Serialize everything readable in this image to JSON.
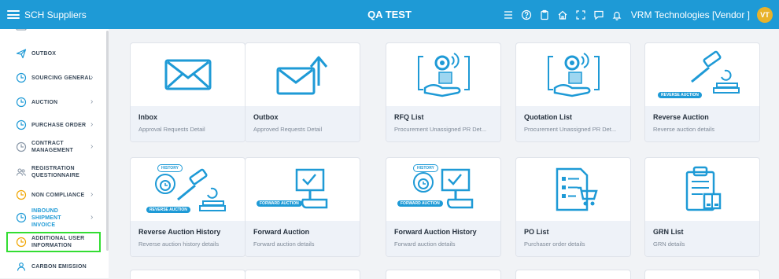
{
  "topbar": {
    "app_name": "SCH Suppliers",
    "title": "QA TEST",
    "user": "VRM Technologies  [Vendor ]",
    "avatar_initials": "VT",
    "accent": "#1e9ad6"
  },
  "sidebar": {
    "items": [
      {
        "label": "OUTBOX",
        "icon": "send-icon",
        "chevron": false
      },
      {
        "label": "SOURCING GENERAL",
        "icon": "clock-icon",
        "chevron": true
      },
      {
        "label": "AUCTION",
        "icon": "clock-icon",
        "chevron": true
      },
      {
        "label": "PURCHASE ORDER",
        "icon": "clock-icon",
        "chevron": true
      },
      {
        "label": "CONTRACT MANAGEMENT",
        "icon": "clock-icon",
        "chevron": true
      },
      {
        "label": "REGISTRATION QUESTIONNAIRE",
        "icon": "users-icon",
        "chevron": false
      },
      {
        "label": "NON COMPLIANCE",
        "icon": "clock-icon",
        "chevron": true
      },
      {
        "label": "INBOUND SHIPMENT INVOICE",
        "icon": "clock-icon",
        "chevron": true
      },
      {
        "label": "ADDITIONAL USER INFORMATION",
        "icon": "clock-icon",
        "chevron": false
      },
      {
        "label": "CARBON EMISSION",
        "icon": "user-icon",
        "chevron": false
      }
    ]
  },
  "cards": [
    {
      "title": "Inbox",
      "subtitle": "Approval Requests Detail",
      "icon": "envelope-icon"
    },
    {
      "title": "Outbox",
      "subtitle": "Approved Requests Detail",
      "icon": "envelope-send-icon"
    },
    {
      "title": "RFQ List",
      "subtitle": "Procurement Unassigned PR Det...",
      "icon": "gear-hand-icon"
    },
    {
      "title": "Quotation List",
      "subtitle": "Procurement Unassigned PR Det...",
      "icon": "gear-hand-icon"
    },
    {
      "title": "Reverse Auction",
      "subtitle": "Reverse auction details",
      "icon": "gavel-icon",
      "ribbon": "REVERSE AUCTION"
    },
    {
      "title": "Reverse Auction History",
      "subtitle": "Reverse auction history details",
      "icon": "gavel-history-icon",
      "ribbon": "REVERSE AUCTION",
      "badge": "HISTORY"
    },
    {
      "title": "Forward Auction",
      "subtitle": "Forward auction details",
      "icon": "forward-auction-icon",
      "ribbon": "FORWARD AUCTION"
    },
    {
      "title": "Forward Auction History",
      "subtitle": "Forward auction details",
      "icon": "forward-auction-history-icon",
      "ribbon": "FORWARD AUCTION",
      "badge": "HISTORY"
    },
    {
      "title": "PO List",
      "subtitle": "Purchaser order details",
      "icon": "po-list-icon"
    },
    {
      "title": "GRN List",
      "subtitle": "GRN details",
      "icon": "clipboard-icon"
    }
  ]
}
